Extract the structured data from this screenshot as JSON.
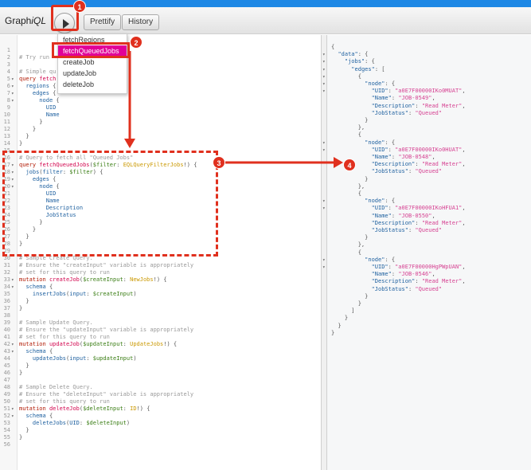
{
  "app": {
    "title_prefix": "Graph",
    "title_suffix": "iQL"
  },
  "toolbar": {
    "play_icon": "play-icon",
    "prettify_label": "Prettify",
    "history_label": "History"
  },
  "dropdown": {
    "items": [
      "fetchRegions",
      "fetchQueuedJobs",
      "createJob",
      "updateJob",
      "deleteJob"
    ],
    "selected_index": 1
  },
  "annotations": {
    "badges": [
      "1",
      "2",
      "3",
      "4"
    ],
    "color": "#e0301e"
  },
  "colors": {
    "accent": "#e10098",
    "top_strip": "#1e88e5"
  },
  "editor": {
    "lines": [
      [],
      [
        [
          "# Try run",
          "comment"
        ]
      ],
      [],
      [
        [
          "# Simple qu",
          "comment"
        ]
      ],
      [
        [
          "query ",
          "keyword"
        ],
        [
          "fetch",
          "def"
        ]
      ],
      [
        [
          "  ",
          ""
        ],
        [
          "regions",
          "property"
        ],
        [
          " {",
          "punct"
        ]
      ],
      [
        [
          "    ",
          ""
        ],
        [
          "edges",
          "property"
        ],
        [
          " {",
          "punct"
        ]
      ],
      [
        [
          "      ",
          ""
        ],
        [
          "node",
          "property"
        ],
        [
          " {",
          "punct"
        ]
      ],
      [
        [
          "        ",
          ""
        ],
        [
          "UID",
          "property"
        ]
      ],
      [
        [
          "        ",
          ""
        ],
        [
          "Name",
          "property"
        ]
      ],
      [
        [
          "      }",
          "punct"
        ]
      ],
      [
        [
          "    }",
          "punct"
        ]
      ],
      [
        [
          "  }",
          "punct"
        ]
      ],
      [
        [
          "}",
          "punct"
        ]
      ],
      [],
      [
        [
          "# Query to fetch all \"Queued Jobs\"",
          "comment"
        ]
      ],
      [
        [
          "query ",
          "keyword"
        ],
        [
          "fetchQueuedJobs",
          "def"
        ],
        [
          "(",
          "punct"
        ],
        [
          "$filter",
          "variable"
        ],
        [
          ": ",
          "punct"
        ],
        [
          "EQLQueryFilterJobs",
          "type"
        ],
        [
          "!) {",
          "punct"
        ]
      ],
      [
        [
          "  ",
          ""
        ],
        [
          "jobs",
          "property"
        ],
        [
          "(",
          "punct"
        ],
        [
          "filter",
          "property"
        ],
        [
          ": ",
          "punct"
        ],
        [
          "$filter",
          "variable"
        ],
        [
          ") {",
          "punct"
        ]
      ],
      [
        [
          "    ",
          ""
        ],
        [
          "edges",
          "property"
        ],
        [
          " {",
          "punct"
        ]
      ],
      [
        [
          "      ",
          ""
        ],
        [
          "node",
          "property"
        ],
        [
          " {",
          "punct"
        ]
      ],
      [
        [
          "        ",
          ""
        ],
        [
          "UID",
          "property"
        ]
      ],
      [
        [
          "        ",
          ""
        ],
        [
          "Name",
          "property"
        ]
      ],
      [
        [
          "        ",
          ""
        ],
        [
          "Description",
          "property"
        ]
      ],
      [
        [
          "        ",
          ""
        ],
        [
          "JobStatus",
          "property"
        ]
      ],
      [
        [
          "      }",
          "punct"
        ]
      ],
      [
        [
          "    }",
          "punct"
        ]
      ],
      [
        [
          "  }",
          "punct"
        ]
      ],
      [
        [
          "}",
          "punct"
        ]
      ],
      [],
      [
        [
          "# Sample Create Query.",
          "comment"
        ]
      ],
      [
        [
          "# Ensure the \"createInput\" variable is appropriately",
          "comment"
        ]
      ],
      [
        [
          "# set for this query to run",
          "comment"
        ]
      ],
      [
        [
          "mutation ",
          "keyword"
        ],
        [
          "createJob",
          "def"
        ],
        [
          "(",
          "punct"
        ],
        [
          "$createInput",
          "variable"
        ],
        [
          ": ",
          "punct"
        ],
        [
          "NewJobs",
          "type"
        ],
        [
          "!) {",
          "punct"
        ]
      ],
      [
        [
          "  ",
          ""
        ],
        [
          "schema",
          "property"
        ],
        [
          " {",
          "punct"
        ]
      ],
      [
        [
          "    ",
          ""
        ],
        [
          "insertJobs",
          "property"
        ],
        [
          "(",
          "punct"
        ],
        [
          "input",
          "property"
        ],
        [
          ": ",
          "punct"
        ],
        [
          "$createInput",
          "variable"
        ],
        [
          ")",
          "punct"
        ]
      ],
      [
        [
          "  }",
          "punct"
        ]
      ],
      [
        [
          "}",
          "punct"
        ]
      ],
      [],
      [
        [
          "# Sample Update Query.",
          "comment"
        ]
      ],
      [
        [
          "# Ensure the \"updateInput\" variable is appropriately",
          "comment"
        ]
      ],
      [
        [
          "# set for this query to run",
          "comment"
        ]
      ],
      [
        [
          "mutation ",
          "keyword"
        ],
        [
          "updateJob",
          "def"
        ],
        [
          "(",
          "punct"
        ],
        [
          "$updateInput",
          "variable"
        ],
        [
          ": ",
          "punct"
        ],
        [
          "UpdateJobs",
          "type"
        ],
        [
          "!) {",
          "punct"
        ]
      ],
      [
        [
          "  ",
          ""
        ],
        [
          "schema",
          "property"
        ],
        [
          " {",
          "punct"
        ]
      ],
      [
        [
          "    ",
          ""
        ],
        [
          "updateJobs",
          "property"
        ],
        [
          "(",
          "punct"
        ],
        [
          "input",
          "property"
        ],
        [
          ": ",
          "punct"
        ],
        [
          "$updateInput",
          "variable"
        ],
        [
          ")",
          "punct"
        ]
      ],
      [
        [
          "  }",
          "punct"
        ]
      ],
      [
        [
          "}",
          "punct"
        ]
      ],
      [],
      [
        [
          "# Sample Delete Query.",
          "comment"
        ]
      ],
      [
        [
          "# Ensure the \"deleteInput\" variable is appropriately",
          "comment"
        ]
      ],
      [
        [
          "# set for this query to run",
          "comment"
        ]
      ],
      [
        [
          "mutation ",
          "keyword"
        ],
        [
          "deleteJob",
          "def"
        ],
        [
          "(",
          "punct"
        ],
        [
          "$deleteInput",
          "variable"
        ],
        [
          ": ",
          "punct"
        ],
        [
          "ID",
          "type"
        ],
        [
          "!) {",
          "punct"
        ]
      ],
      [
        [
          "  ",
          ""
        ],
        [
          "schema",
          "property"
        ],
        [
          " {",
          "punct"
        ]
      ],
      [
        [
          "    ",
          ""
        ],
        [
          "deleteJobs",
          "property"
        ],
        [
          "(",
          "punct"
        ],
        [
          "UID",
          "property"
        ],
        [
          ": ",
          "punct"
        ],
        [
          "$deleteInput",
          "variable"
        ],
        [
          ")",
          "punct"
        ]
      ],
      [
        [
          "  }",
          "punct"
        ]
      ],
      [
        [
          "}",
          "punct"
        ]
      ],
      []
    ],
    "fold_lines": [
      4,
      5,
      6,
      7,
      16,
      17,
      18,
      19,
      32,
      33,
      41,
      42,
      50,
      51
    ],
    "fold_icon": "fold-arrow-icon"
  },
  "result": {
    "lines": [
      [
        [
          "{",
          "punct"
        ]
      ],
      [
        [
          "  ",
          ""
        ],
        [
          "\"data\"",
          "property"
        ],
        [
          ": {",
          "punct"
        ]
      ],
      [
        [
          "    ",
          ""
        ],
        [
          "\"jobs\"",
          "property"
        ],
        [
          ": {",
          "punct"
        ]
      ],
      [
        [
          "      ",
          ""
        ],
        [
          "\"edges\"",
          "property"
        ],
        [
          ": [",
          "punct"
        ]
      ],
      [
        [
          "        {",
          "punct"
        ]
      ],
      [
        [
          "          ",
          ""
        ],
        [
          "\"node\"",
          "property"
        ],
        [
          ": {",
          "punct"
        ]
      ],
      [
        [
          "            ",
          ""
        ],
        [
          "\"UID\"",
          "property"
        ],
        [
          ": ",
          "punct"
        ],
        [
          "\"a0E7F00000IKo0MUAT\"",
          "string"
        ],
        [
          ",",
          "punct"
        ]
      ],
      [
        [
          "            ",
          ""
        ],
        [
          "\"Name\"",
          "property"
        ],
        [
          ": ",
          "punct"
        ],
        [
          "\"JOB-0549\"",
          "string"
        ],
        [
          ",",
          "punct"
        ]
      ],
      [
        [
          "            ",
          ""
        ],
        [
          "\"Description\"",
          "property"
        ],
        [
          ": ",
          "punct"
        ],
        [
          "\"Read Meter\"",
          "string"
        ],
        [
          ",",
          "punct"
        ]
      ],
      [
        [
          "            ",
          ""
        ],
        [
          "\"JobStatus\"",
          "property"
        ],
        [
          ": ",
          "punct"
        ],
        [
          "\"Queued\"",
          "string"
        ]
      ],
      [
        [
          "          }",
          "punct"
        ]
      ],
      [
        [
          "        },",
          "punct"
        ]
      ],
      [
        [
          "        {",
          "punct"
        ]
      ],
      [
        [
          "          ",
          ""
        ],
        [
          "\"node\"",
          "property"
        ],
        [
          ": {",
          "punct"
        ]
      ],
      [
        [
          "            ",
          ""
        ],
        [
          "\"UID\"",
          "property"
        ],
        [
          ": ",
          "punct"
        ],
        [
          "\"a0E7F00000IKo0HUAT\"",
          "string"
        ],
        [
          ",",
          "punct"
        ]
      ],
      [
        [
          "            ",
          ""
        ],
        [
          "\"Name\"",
          "property"
        ],
        [
          ": ",
          "punct"
        ],
        [
          "\"JOB-0548\"",
          "string"
        ],
        [
          ",",
          "punct"
        ]
      ],
      [
        [
          "            ",
          ""
        ],
        [
          "\"Description\"",
          "property"
        ],
        [
          ": ",
          "punct"
        ],
        [
          "\"Read Meter\"",
          "string"
        ],
        [
          ",",
          "punct"
        ]
      ],
      [
        [
          "            ",
          ""
        ],
        [
          "\"JobStatus\"",
          "property"
        ],
        [
          ": ",
          "punct"
        ],
        [
          "\"Queued\"",
          "string"
        ]
      ],
      [
        [
          "          }",
          "punct"
        ]
      ],
      [
        [
          "        },",
          "punct"
        ]
      ],
      [
        [
          "        {",
          "punct"
        ]
      ],
      [
        [
          "          ",
          ""
        ],
        [
          "\"node\"",
          "property"
        ],
        [
          ": {",
          "punct"
        ]
      ],
      [
        [
          "            ",
          ""
        ],
        [
          "\"UID\"",
          "property"
        ],
        [
          ": ",
          "punct"
        ],
        [
          "\"a0E7F00000IKoHFUA1\"",
          "string"
        ],
        [
          ",",
          "punct"
        ]
      ],
      [
        [
          "            ",
          ""
        ],
        [
          "\"Name\"",
          "property"
        ],
        [
          ": ",
          "punct"
        ],
        [
          "\"JOB-0550\"",
          "string"
        ],
        [
          ",",
          "punct"
        ]
      ],
      [
        [
          "            ",
          ""
        ],
        [
          "\"Description\"",
          "property"
        ],
        [
          ": ",
          "punct"
        ],
        [
          "\"Read Meter\"",
          "string"
        ],
        [
          ",",
          "punct"
        ]
      ],
      [
        [
          "            ",
          ""
        ],
        [
          "\"JobStatus\"",
          "property"
        ],
        [
          ": ",
          "punct"
        ],
        [
          "\"Queued\"",
          "string"
        ]
      ],
      [
        [
          "          }",
          "punct"
        ]
      ],
      [
        [
          "        },",
          "punct"
        ]
      ],
      [
        [
          "        {",
          "punct"
        ]
      ],
      [
        [
          "          ",
          ""
        ],
        [
          "\"node\"",
          "property"
        ],
        [
          ": {",
          "punct"
        ]
      ],
      [
        [
          "            ",
          ""
        ],
        [
          "\"UID\"",
          "property"
        ],
        [
          ": ",
          "punct"
        ],
        [
          "\"a0E7F00000HgPWpUAN\"",
          "string"
        ],
        [
          ",",
          "punct"
        ]
      ],
      [
        [
          "            ",
          ""
        ],
        [
          "\"Name\"",
          "property"
        ],
        [
          ": ",
          "punct"
        ],
        [
          "\"JOB-0546\"",
          "string"
        ],
        [
          ",",
          "punct"
        ]
      ],
      [
        [
          "            ",
          ""
        ],
        [
          "\"Description\"",
          "property"
        ],
        [
          ": ",
          "punct"
        ],
        [
          "\"Read Meter\"",
          "string"
        ],
        [
          ",",
          "punct"
        ]
      ],
      [
        [
          "            ",
          ""
        ],
        [
          "\"JobStatus\"",
          "property"
        ],
        [
          ": ",
          "punct"
        ],
        [
          "\"Queued\"",
          "string"
        ]
      ],
      [
        [
          "          }",
          "punct"
        ]
      ],
      [
        [
          "        }",
          "punct"
        ]
      ],
      [
        [
          "      ]",
          "punct"
        ]
      ],
      [
        [
          "    }",
          "punct"
        ]
      ],
      [
        [
          "  }",
          "punct"
        ]
      ],
      [
        [
          "}",
          "punct"
        ]
      ]
    ],
    "fold_lines": [
      1,
      2,
      3,
      4,
      5,
      6,
      13,
      14,
      21,
      22,
      29,
      30
    ],
    "fold_icon": "fold-arrow-icon"
  }
}
